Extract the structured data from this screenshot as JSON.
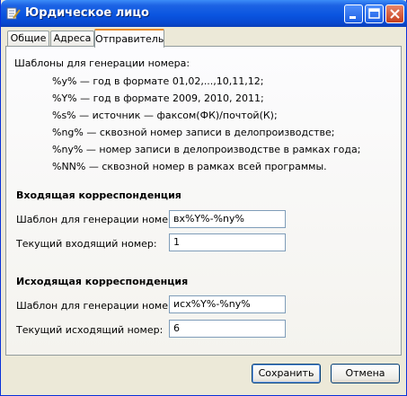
{
  "window": {
    "title": "Юрдическое лицо"
  },
  "tabs": [
    {
      "label": "Общие"
    },
    {
      "label": "Адреса"
    },
    {
      "label": "Отправитель"
    }
  ],
  "templates_help": {
    "heading": "Шаблоны для генерации номера:",
    "lines": [
      "%y% — год в формате 01,02,...,10,11,12;",
      "%Y% — год в формате 2009, 2010, 2011;",
      "%s% — источник — факсом(ФК)/почтой(К);",
      "%ng% — сквозной номер записи в делопроизводстве;",
      "%ny% — номер записи в делопроизводстве в рамках года;",
      "%NN% — сквозной номер в рамках всей программы."
    ]
  },
  "incoming": {
    "section_title": "Входящая корреспонденция",
    "template_label": "Шаблон для генерации номера:",
    "template_value": "вх%Y%-%ny%",
    "current_label": "Текущий входящий номер:",
    "current_value": "1"
  },
  "outgoing": {
    "section_title": "Исходящая корреспонденция",
    "template_label": "Шаблон для генерации номера:",
    "template_value": "исх%Y%-%ny%",
    "current_label": "Текущий исходящий номер:",
    "current_value": "6"
  },
  "buttons": {
    "save": "Сохранить",
    "cancel": "Отмена"
  }
}
